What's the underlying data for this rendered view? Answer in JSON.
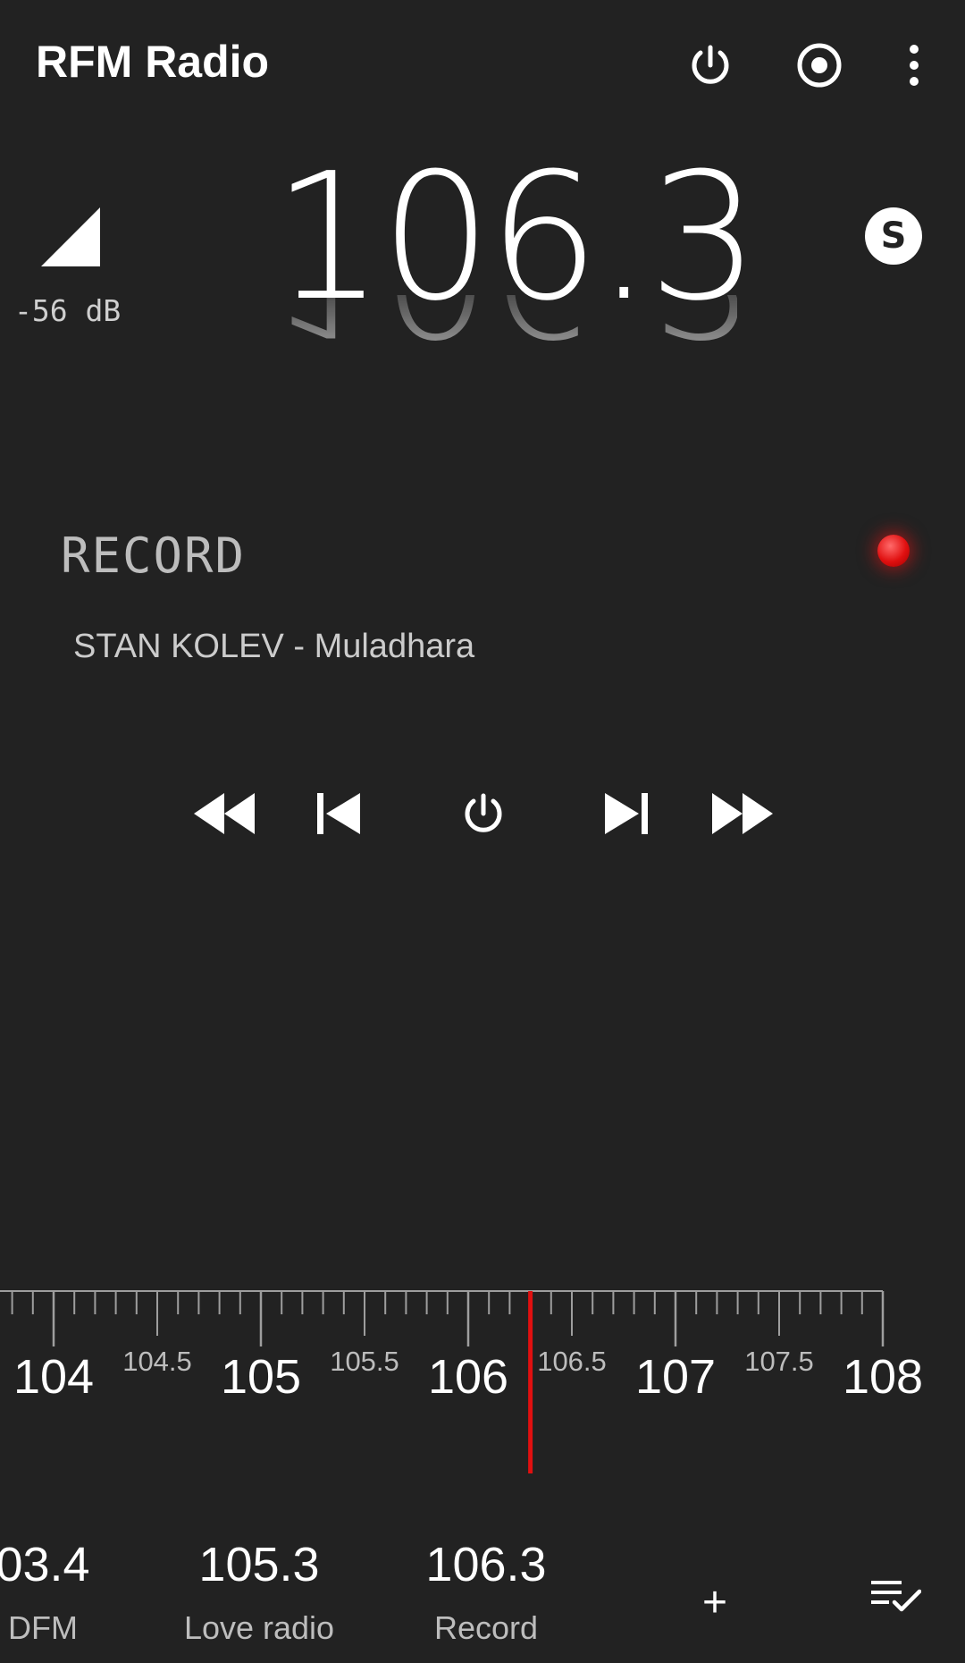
{
  "app": {
    "title": "RFM Radio"
  },
  "appbar": {
    "icons": [
      "power-icon",
      "record-icon",
      "more-vert-icon"
    ]
  },
  "signal": {
    "value": "-56",
    "unit": "dB",
    "display": "-56 dB"
  },
  "frequency": {
    "current": "106.3",
    "stereo_badge": "S"
  },
  "rds": {
    "station_name": "RECORD",
    "track": "STAN KOLEV - Muladhara"
  },
  "controls": {
    "icons": [
      "fast-rewind-icon",
      "skip-previous-icon",
      "power-icon",
      "skip-next-icon",
      "fast-forward-icon"
    ]
  },
  "tuner": {
    "major_labels": [
      "104",
      "105",
      "106",
      "107",
      "108"
    ],
    "minor_labels": [
      "104.5",
      "105.5",
      "106.5",
      "107.5"
    ],
    "start_mhz": 104.0,
    "end_mhz": 108.0,
    "needle_mhz": 106.3,
    "needle_color": "#e01010"
  },
  "presets": [
    {
      "freq": "03.4",
      "name": "DFM"
    },
    {
      "freq": "105.3",
      "name": "Love radio"
    },
    {
      "freq": "106.3",
      "name": "Record"
    }
  ],
  "preset_actions": {
    "add_label": "+",
    "list_icon": "playlist-check-icon"
  },
  "colors": {
    "background": "#222222",
    "accent_red": "#e01010",
    "text_primary": "#ffffff",
    "text_secondary": "#bdbdbd"
  }
}
